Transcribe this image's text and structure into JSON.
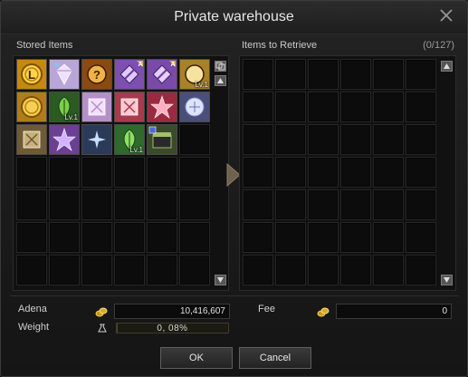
{
  "window": {
    "title": "Private warehouse"
  },
  "stored": {
    "label": "Stored Items",
    "items": [
      {
        "name": "adena-coin-icon",
        "bg": "#c48a10",
        "fg": "#ffd24a",
        "shape": "coin",
        "glyph": "L",
        "badge": "",
        "level": ""
      },
      {
        "name": "crystal-gem-icon",
        "bg": "#b9a6d8",
        "fg": "#eee0ff",
        "shape": "gem",
        "glyph": "",
        "badge": "star",
        "level": ""
      },
      {
        "name": "mystery-box-icon",
        "bg": "#8a4a12",
        "fg": "#f2b24a",
        "shape": "circle",
        "glyph": "?",
        "badge": "",
        "level": ""
      },
      {
        "name": "enchant-scroll-icon",
        "bg": "#7d4fb0",
        "fg": "#e0c8ff",
        "shape": "diamond",
        "glyph": "",
        "badge": "A",
        "level": ""
      },
      {
        "name": "enchant-scroll-armor-icon",
        "bg": "#7a4aa8",
        "fg": "#e4cfff",
        "shape": "diamond",
        "glyph": "",
        "badge": "A",
        "level": ""
      },
      {
        "name": "talisman-icon",
        "bg": "#a8822a",
        "fg": "#f6e3a0",
        "shape": "circle",
        "glyph": "",
        "badge": "",
        "level": "Lv.1"
      },
      {
        "name": "gold-medal-icon",
        "bg": "#b07d1a",
        "fg": "#f5cf55",
        "shape": "coin",
        "glyph": "",
        "badge": "",
        "level": ""
      },
      {
        "name": "herb-icon",
        "bg": "#2b5a22",
        "fg": "#7ad04a",
        "shape": "leaf",
        "glyph": "",
        "badge": "",
        "level": "Lv.1"
      },
      {
        "name": "rune-stone-icon",
        "bg": "#b58fc8",
        "fg": "#f3e0ff",
        "shape": "square",
        "glyph": "",
        "badge": "",
        "level": ""
      },
      {
        "name": "red-rune-icon",
        "bg": "#a83a4c",
        "fg": "#ffc8d2",
        "shape": "square",
        "glyph": "",
        "badge": "",
        "level": ""
      },
      {
        "name": "crimson-emblem-icon",
        "bg": "#9a2a40",
        "fg": "#ffb0c0",
        "shape": "star",
        "glyph": "",
        "badge": "",
        "level": ""
      },
      {
        "name": "soul-orb-icon",
        "bg": "#4a4e7a",
        "fg": "#e8ecff",
        "shape": "orb",
        "glyph": "",
        "badge": "",
        "level": ""
      },
      {
        "name": "armor-chest-icon",
        "bg": "#6e5a34",
        "fg": "#c9b07a",
        "shape": "square",
        "glyph": "",
        "badge": "",
        "level": ""
      },
      {
        "name": "purple-sigil-icon",
        "bg": "#6b3f95",
        "fg": "#d2b2ff",
        "shape": "star",
        "glyph": "",
        "badge": "",
        "level": ""
      },
      {
        "name": "blue-crystal-icon",
        "bg": "#2c3a5a",
        "fg": "#c8e0ff",
        "shape": "burst",
        "glyph": "",
        "badge": "",
        "level": ""
      },
      {
        "name": "green-lotus-icon",
        "bg": "#2f6a2c",
        "fg": "#8ddf66",
        "shape": "leaf",
        "glyph": "",
        "badge": "",
        "level": "Lv.1"
      },
      {
        "name": "treasure-chest-icon",
        "bg": "#3a4a2a",
        "fg": "#9fbf6a",
        "shape": "chest",
        "glyph": "",
        "badge": "dice",
        "level": ""
      }
    ]
  },
  "retrieve": {
    "label": "Items to Retrieve",
    "count": "(0/127)"
  },
  "footer": {
    "adena_label": "Adena",
    "adena_value": "10,416,607",
    "weight_label": "Weight",
    "weight_value": "0, 08%",
    "weight_fraction": 0.0008,
    "fee_label": "Fee",
    "fee_value": "0"
  },
  "buttons": {
    "ok": "OK",
    "cancel": "Cancel"
  },
  "icons": {
    "close": "close-icon",
    "transfer": "arrow-right-icon",
    "coins": "coins-icon",
    "weight": "weight-bag-icon"
  }
}
